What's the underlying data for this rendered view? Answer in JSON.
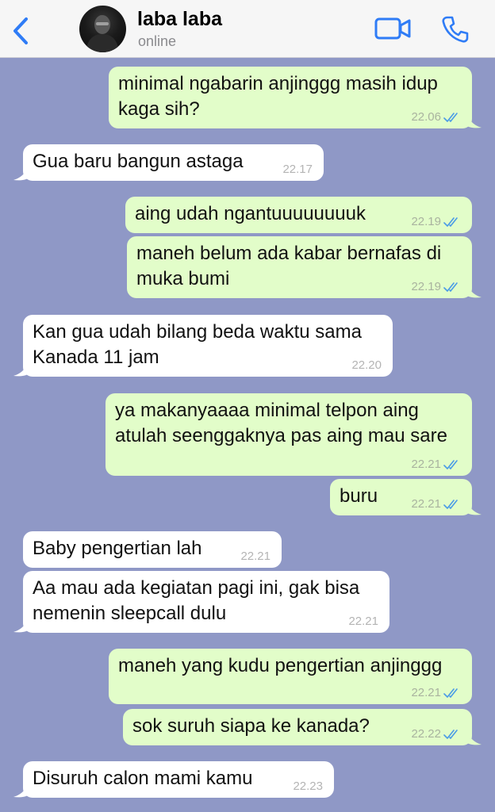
{
  "header": {
    "contact_name": "laba laba",
    "status": "online"
  },
  "icons": {
    "back": "chevron-left-icon",
    "video": "video-camera-icon",
    "phone": "phone-icon",
    "read": "double-check-icon"
  },
  "colors": {
    "accent": "#2f7cf6",
    "chat_background": "#8f98c6",
    "outgoing_bubble": "#e2fdc9",
    "incoming_bubble": "#ffffff"
  },
  "messages": [
    {
      "direction": "outgoing",
      "lines": [
        "minimal ngabarin anjinggg masih idup",
        "kaga sih?"
      ],
      "time": "22.06",
      "read": true
    },
    {
      "direction": "incoming",
      "lines": [
        "Gua baru bangun astaga"
      ],
      "time": "22.17"
    },
    {
      "direction": "outgoing",
      "lines": [
        "aing udah ngantuuuuuuuuk"
      ],
      "time": "22.19",
      "read": true
    },
    {
      "direction": "outgoing",
      "lines": [
        "maneh belum ada kabar bernafas di",
        "muka bumi"
      ],
      "time": "22.19",
      "read": true
    },
    {
      "direction": "incoming",
      "lines": [
        "Kan gua udah bilang beda waktu sama",
        "Kanada 11 jam"
      ],
      "time": "22.20"
    },
    {
      "direction": "outgoing",
      "lines": [
        "ya makanyaaaa minimal telpon aing",
        "atulah seenggaknya pas aing mau sare"
      ],
      "time": "22.21",
      "read": true
    },
    {
      "direction": "outgoing",
      "lines": [
        "buru"
      ],
      "time": "22.21",
      "read": true
    },
    {
      "direction": "incoming",
      "lines": [
        "Baby pengertian lah"
      ],
      "time": "22.21"
    },
    {
      "direction": "incoming",
      "lines": [
        "Aa mau ada kegiatan pagi ini, gak bisa",
        "nemenin sleepcall dulu"
      ],
      "time": "22.21"
    },
    {
      "direction": "outgoing",
      "lines": [
        "maneh yang kudu pengertian anjinggg"
      ],
      "time": "22.21",
      "read": true
    },
    {
      "direction": "outgoing",
      "lines": [
        "sok suruh siapa ke kanada?"
      ],
      "time": "22.22",
      "read": true
    },
    {
      "direction": "incoming",
      "lines": [
        "Disuruh calon mami kamu"
      ],
      "time": "22.23"
    }
  ]
}
